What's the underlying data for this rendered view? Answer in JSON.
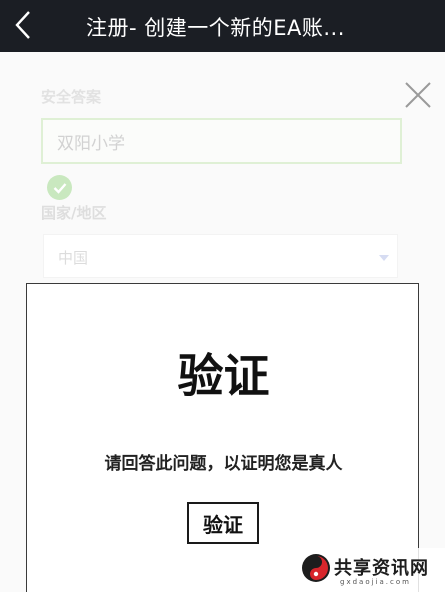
{
  "header": {
    "title": "注册- 创建一个新的EA账..."
  },
  "form": {
    "answer_label": "安全答案",
    "answer_value": "双阳小学",
    "country_label": "国家/地区",
    "country_value": "中国"
  },
  "dialog": {
    "title": "验证",
    "message": "请回答此问题，以证明您是真人",
    "button_label": "验证"
  },
  "watermark": {
    "name": "共享资讯网",
    "url": "gxdaojia.com"
  },
  "colors": {
    "topbar": "#1b1e24",
    "success_green": "#c9e8bf"
  }
}
